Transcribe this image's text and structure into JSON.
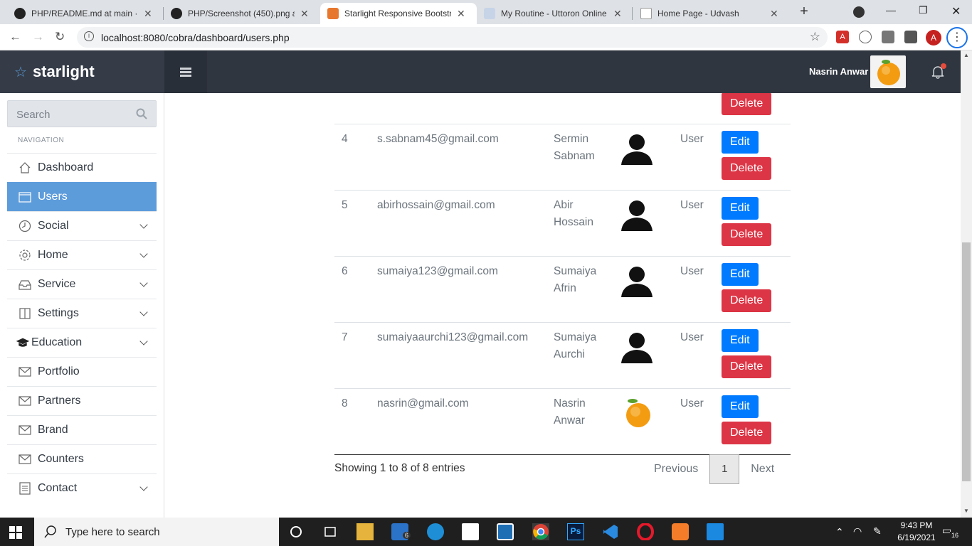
{
  "browser": {
    "tabs": [
      {
        "title": "PHP/README.md at main · ay",
        "active": false
      },
      {
        "title": "PHP/Screenshot (450).png at",
        "active": false
      },
      {
        "title": "Starlight Responsive Bootstra",
        "active": true
      },
      {
        "title": "My Routine - Uttoron Online",
        "active": false
      },
      {
        "title": "Home Page - Udvash",
        "active": false
      }
    ],
    "url": "localhost:8080/cobra/dashboard/users.php",
    "profile_initial": "A"
  },
  "app": {
    "brand": "starlight",
    "user_name": "Nasrin Anwar"
  },
  "sidebar": {
    "search_placeholder": "Search",
    "nav_label": "NAVIGATION",
    "items": [
      {
        "label": "Dashboard",
        "icon": "home-icon",
        "has_submenu": false,
        "active": false
      },
      {
        "label": "Users",
        "icon": "window-icon",
        "has_submenu": false,
        "active": true
      },
      {
        "label": "Social",
        "icon": "clock-icon",
        "has_submenu": true,
        "active": false
      },
      {
        "label": "Home",
        "icon": "gear-icon",
        "has_submenu": true,
        "active": false
      },
      {
        "label": "Service",
        "icon": "inbox-icon",
        "has_submenu": true,
        "active": false
      },
      {
        "label": "Settings",
        "icon": "book-icon",
        "has_submenu": true,
        "active": false
      },
      {
        "label": "Education",
        "icon": "graduation-cap-icon",
        "has_submenu": true,
        "active": false
      },
      {
        "label": "Portfolio",
        "icon": "envelope-icon",
        "has_submenu": false,
        "active": false
      },
      {
        "label": "Partners",
        "icon": "envelope-icon",
        "has_submenu": false,
        "active": false
      },
      {
        "label": "Brand",
        "icon": "envelope-icon",
        "has_submenu": false,
        "active": false
      },
      {
        "label": "Counters",
        "icon": "envelope-icon",
        "has_submenu": false,
        "active": false
      },
      {
        "label": "Contact",
        "icon": "list-icon",
        "has_submenu": true,
        "active": false
      }
    ]
  },
  "table": {
    "edit_label": "Edit",
    "delete_label": "Delete",
    "rows": [
      {
        "id": "4",
        "email": "s.sabnam45@gmail.com",
        "name": "Sermin Sabnam",
        "photo": "person-silhouette",
        "role": "User"
      },
      {
        "id": "5",
        "email": "abirhossain@gmail.com",
        "name": "Abir Hossain",
        "photo": "person-silhouette",
        "role": "User"
      },
      {
        "id": "6",
        "email": "sumaiya123@gmail.com",
        "name": "Sumaiya Afrin",
        "photo": "person-silhouette",
        "role": "User"
      },
      {
        "id": "7",
        "email": "sumaiyaaurchi123@gmail.com",
        "name": "Sumaiya Aurchi",
        "photo": "person-silhouette",
        "role": "User"
      },
      {
        "id": "8",
        "email": "nasrin@gmail.com",
        "name": "Nasrin Anwar",
        "photo": "orange",
        "role": "User"
      }
    ]
  },
  "footer": {
    "info": "Showing 1 to 8 of 8 entries",
    "previous": "Previous",
    "current_page": "1",
    "next": "Next"
  },
  "taskbar": {
    "search_placeholder": "Type here to search",
    "mail_badge": "6",
    "time": "9:43 PM",
    "date": "6/19/2021",
    "notification_count": "16"
  },
  "colors": {
    "header": "#2f3640",
    "sidebar_active": "#5d9cdb",
    "edit": "#007bff",
    "delete": "#dc3545"
  }
}
